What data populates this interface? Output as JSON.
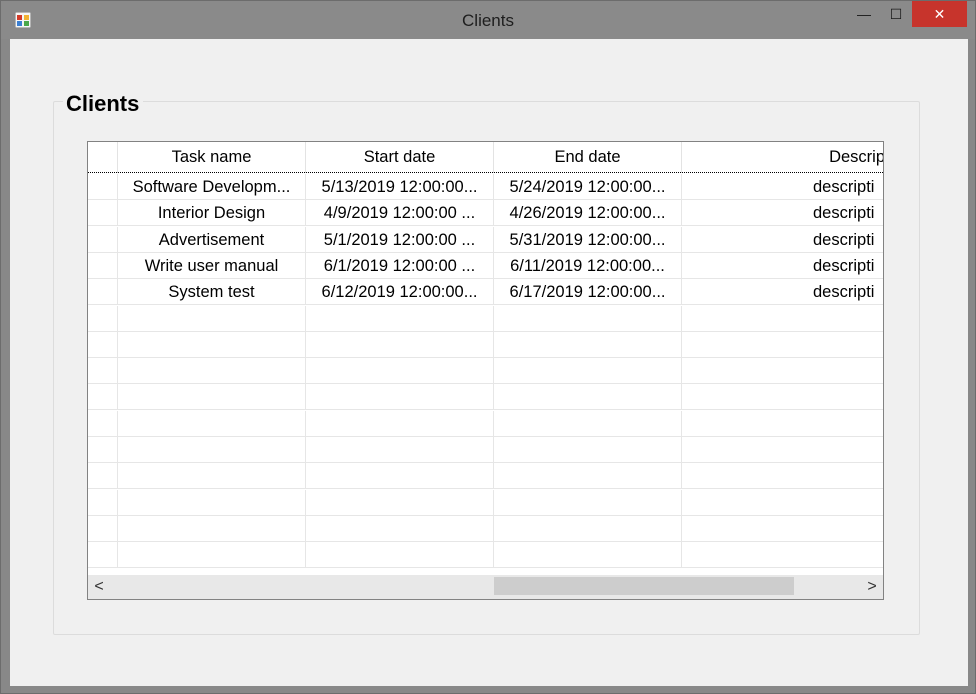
{
  "window": {
    "title": "Clients",
    "controls": {
      "minimize": "—",
      "maximize": "☐",
      "close": "✕"
    }
  },
  "group": {
    "title": "Clients"
  },
  "grid": {
    "columns": [
      "Task name",
      "Start date",
      "End date",
      "Descrip"
    ],
    "rows": [
      [
        "Software Developm...",
        "5/13/2019 12:00:00...",
        "5/24/2019 12:00:00...",
        "descripti"
      ],
      [
        "Interior Design",
        "4/9/2019 12:00:00 ...",
        "4/26/2019 12:00:00...",
        "descripti"
      ],
      [
        "Advertisement",
        "5/1/2019 12:00:00 ...",
        "5/31/2019 12:00:00...",
        "descripti"
      ],
      [
        "Write user manual",
        "6/1/2019 12:00:00 ...",
        "6/11/2019 12:00:00...",
        "descripti"
      ],
      [
        "System test",
        "6/12/2019 12:00:00...",
        "6/17/2019 12:00:00...",
        "descripti"
      ]
    ],
    "empty_row_count": 10,
    "scrollbar": {
      "left_arrow": "<",
      "right_arrow": ">"
    }
  }
}
